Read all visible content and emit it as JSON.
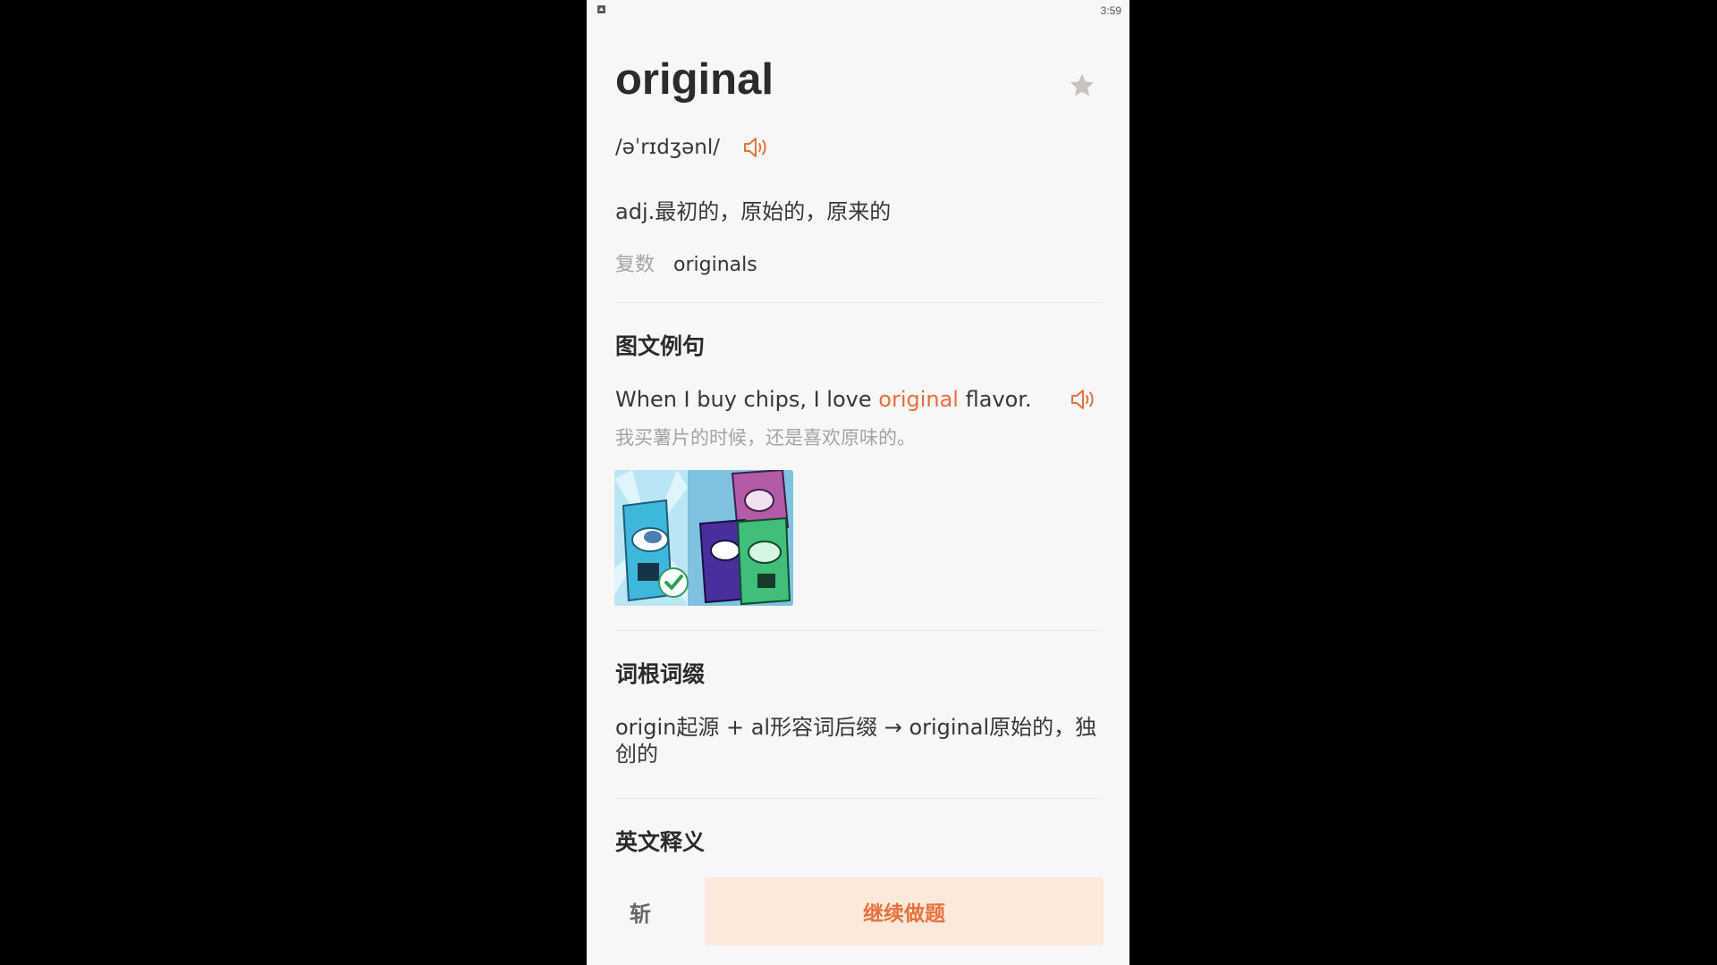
{
  "status_bar": {
    "time": "3:59"
  },
  "word": {
    "headword": "original",
    "phonetic": "/əˈrɪdʒənl/",
    "definition": "adj.最初的，原始的，原来的",
    "plural_label": "复数",
    "plural_value": "originals"
  },
  "example_section": {
    "title": "图文例句",
    "sentence_before": "When I buy chips, I love ",
    "sentence_highlight": "original",
    "sentence_after": " flavor.",
    "translation": "我买薯片的时候，还是喜欢原味的。"
  },
  "root_section": {
    "title": "词根词缀",
    "text": "origin起源 + al形容词后缀 → original原始的，独创的"
  },
  "english_section": {
    "title": "英文释义"
  },
  "bottom_bar": {
    "chop_label": "斩",
    "continue_label": "继续做题"
  },
  "colors": {
    "accent": "#e8713a",
    "accent_light": "#fde9db",
    "text_primary": "#2e2a28",
    "text_secondary": "#a8a2a0",
    "background": "#f7f7f7"
  },
  "icons": {
    "favorite": "star-icon",
    "pronounce": "speaker-icon",
    "example_play": "speaker-icon"
  }
}
